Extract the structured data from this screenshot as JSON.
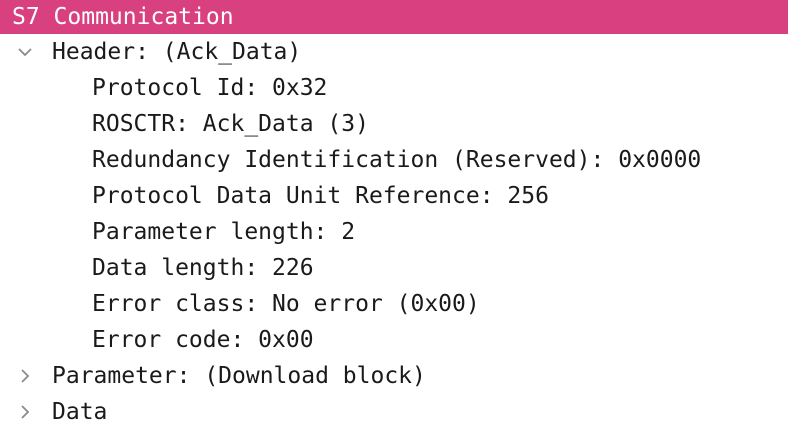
{
  "tree": {
    "title": "S7 Communication",
    "header": {
      "label": "Header: (Ack_Data)",
      "expanded": true,
      "fields": [
        "Protocol Id: 0x32",
        "ROSCTR: Ack_Data (3)",
        "Redundancy Identification (Reserved): 0x0000",
        "Protocol Data Unit Reference: 256",
        "Parameter length: 2",
        "Data length: 226",
        "Error class: No error (0x00)",
        "Error code: 0x00"
      ]
    },
    "parameter": {
      "label": "Parameter: (Download block)",
      "expanded": false
    },
    "data": {
      "label": "Data",
      "expanded": false
    }
  },
  "colors": {
    "selected_bg": "#d9407f",
    "selected_fg": "#ffffff",
    "text": "#1a1a1a",
    "toggle": "#8a8a8a"
  },
  "icons": {
    "expanded": "chevron-down-icon",
    "collapsed": "chevron-right-icon"
  }
}
